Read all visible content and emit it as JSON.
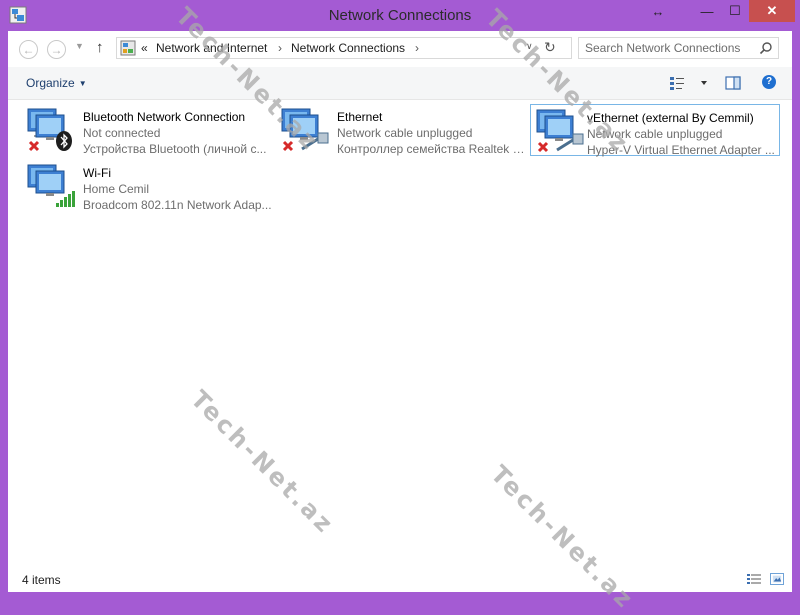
{
  "window": {
    "title": "Network Connections",
    "resize_glyph": "↔",
    "minimize_glyph": "—",
    "maximize_glyph": "☐",
    "close_glyph": "✕"
  },
  "nav": {
    "back_glyph": "←",
    "forward_glyph": "→",
    "recent_glyph": "▼",
    "up_glyph": "↑",
    "breadcrumb_prefix": "«",
    "breadcrumbs": [
      "Network and Internet",
      "Network Connections"
    ],
    "separator": "›",
    "dropdown_glyph": "∨",
    "refresh_glyph": "↻",
    "search_placeholder": "Search Network Connections"
  },
  "toolbar": {
    "organize_label": "Organize",
    "organize_caret": "▼",
    "help_glyph": "?"
  },
  "connections": [
    {
      "name": "Bluetooth Network Connection",
      "status": "Not connected",
      "device": "Устройства Bluetooth (личной с...",
      "overlay_icon": "bluetooth-icon",
      "disabled_marker": "red-x-icon"
    },
    {
      "name": "Ethernet",
      "status": "Network cable unplugged",
      "device": "Контроллер семейства Realtek P...",
      "overlay_icon": "ethernet-cable-icon",
      "disabled_marker": "red-x-icon"
    },
    {
      "name": "vEthernet (external By Cemmil)",
      "status": "Network cable unplugged",
      "device": "Hyper-V Virtual Ethernet Adapter ...",
      "overlay_icon": "ethernet-cable-icon",
      "disabled_marker": "red-x-icon",
      "selected": true
    },
    {
      "name": "Wi-Fi",
      "status": "Home Cemil",
      "device": "Broadcom 802.11n Network Adap...",
      "overlay_icon": "wifi-signal-icon"
    }
  ],
  "statusbar": {
    "item_count": "4 items"
  },
  "watermark": {
    "text": "Tech-Net.az"
  },
  "colors": {
    "window_frame": "#a45bd3",
    "close_button": "#c7504f",
    "selection_border": "#79b6e6",
    "organize_text": "#1e3f6e",
    "disabled_x": "#d62a2a",
    "help_blue": "#1f6fd0"
  }
}
